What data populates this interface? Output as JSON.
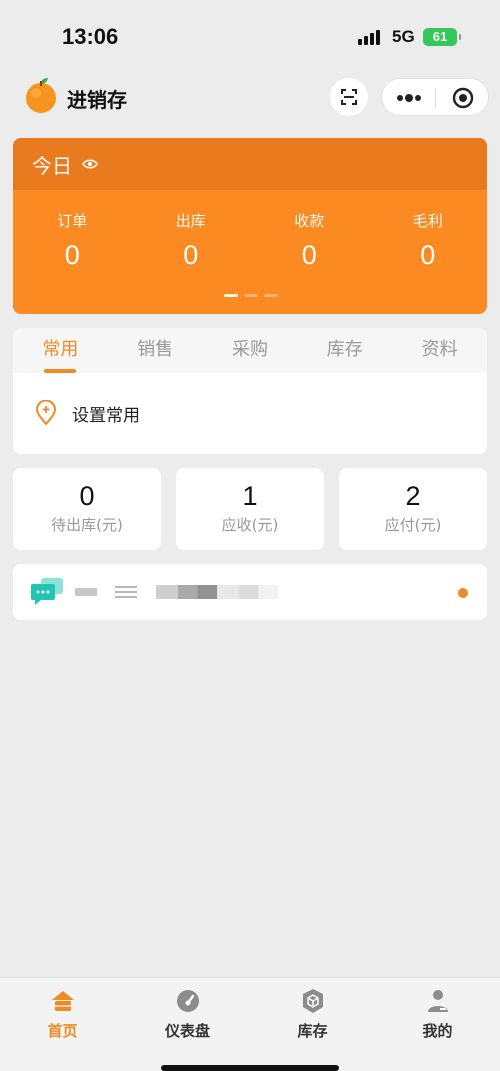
{
  "status_bar": {
    "time": "13:06",
    "network": "5G",
    "battery": "61"
  },
  "nav": {
    "title": "进销存"
  },
  "today": {
    "title": "今日",
    "stats": [
      {
        "label": "订单",
        "value": "0"
      },
      {
        "label": "出库",
        "value": "0"
      },
      {
        "label": "收款",
        "value": "0"
      },
      {
        "label": "毛利",
        "value": "0"
      }
    ]
  },
  "menu": {
    "tabs": [
      "常用",
      "销售",
      "采购",
      "库存",
      "资料"
    ],
    "active_tab": "常用",
    "set_common_label": "设置常用"
  },
  "kpis": [
    {
      "value": "0",
      "label": "待出库(元)"
    },
    {
      "value": "1",
      "label": "应收(元)"
    },
    {
      "value": "2",
      "label": "应付(元)"
    }
  ],
  "tab_bar": [
    {
      "label": "首页",
      "icon": "home-icon",
      "active": true
    },
    {
      "label": "仪表盘",
      "icon": "dashboard-icon",
      "active": false
    },
    {
      "label": "库存",
      "icon": "inventory-box-icon",
      "active": false
    },
    {
      "label": "我的",
      "icon": "user-icon",
      "active": false
    }
  ],
  "colors": {
    "accent": "#f08a24",
    "card_orange": "#fb8a22",
    "card_header": "#ea7a1e",
    "background": "#ececec"
  }
}
